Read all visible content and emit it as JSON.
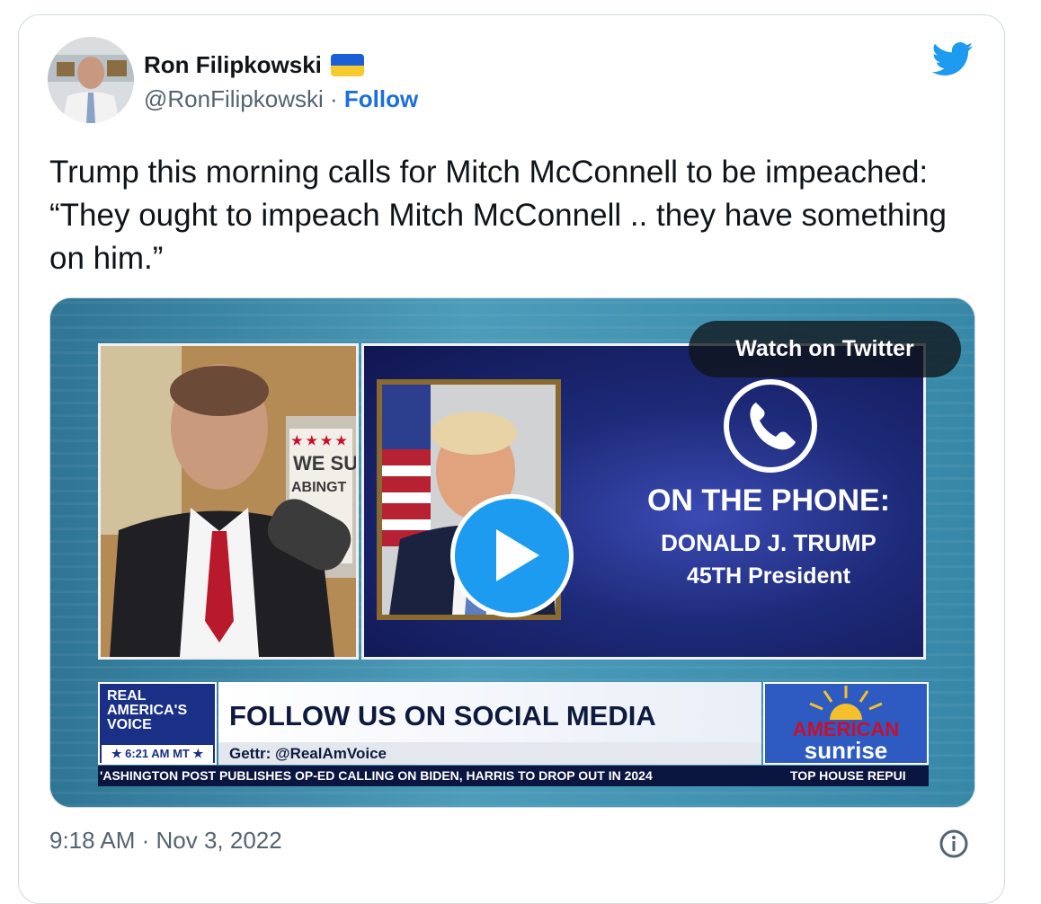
{
  "author": {
    "display_name": "Ron Filipkowski",
    "handle": "@RonFilipkowski",
    "separator": "·",
    "follow_label": "Follow",
    "flag_icon": "ukraine-flag-icon"
  },
  "tweet": {
    "text": "Trump this morning calls for Mitch McConnell to be impeached: “They ought to impeach Mitch McConnell .. they have something on him.”",
    "timestamp": "9:18 AM · Nov 3, 2022"
  },
  "media": {
    "watch_label": "Watch on Twitter",
    "on_phone": "ON THE PHONE:",
    "caller_name": "DONALD J. TRUMP",
    "caller_title": "45TH President",
    "sign_line1": "WE SU",
    "sign_line2": "ABINGT",
    "network_logo": [
      "REAL",
      "AMERICA'S",
      "VOICE"
    ],
    "network_time": "★ 6:21 AM MT ★",
    "banner_title": "FOLLOW US ON SOCIAL MEDIA",
    "banner_sub": "Gettr: @RealAmVoice",
    "show_logo_1": "AMERICAN",
    "show_logo_2": "sunrise",
    "ticker_1": "'ASHINGTON POST PUBLISHES OP-ED CALLING ON BIDEN, HARRIS TO DROP OUT IN 2024",
    "ticker_2": "TOP HOUSE REPUI"
  },
  "colors": {
    "twitter_blue": "#1d9bf0",
    "follow_blue": "#1d6fd8",
    "secondary_text": "#536471"
  }
}
